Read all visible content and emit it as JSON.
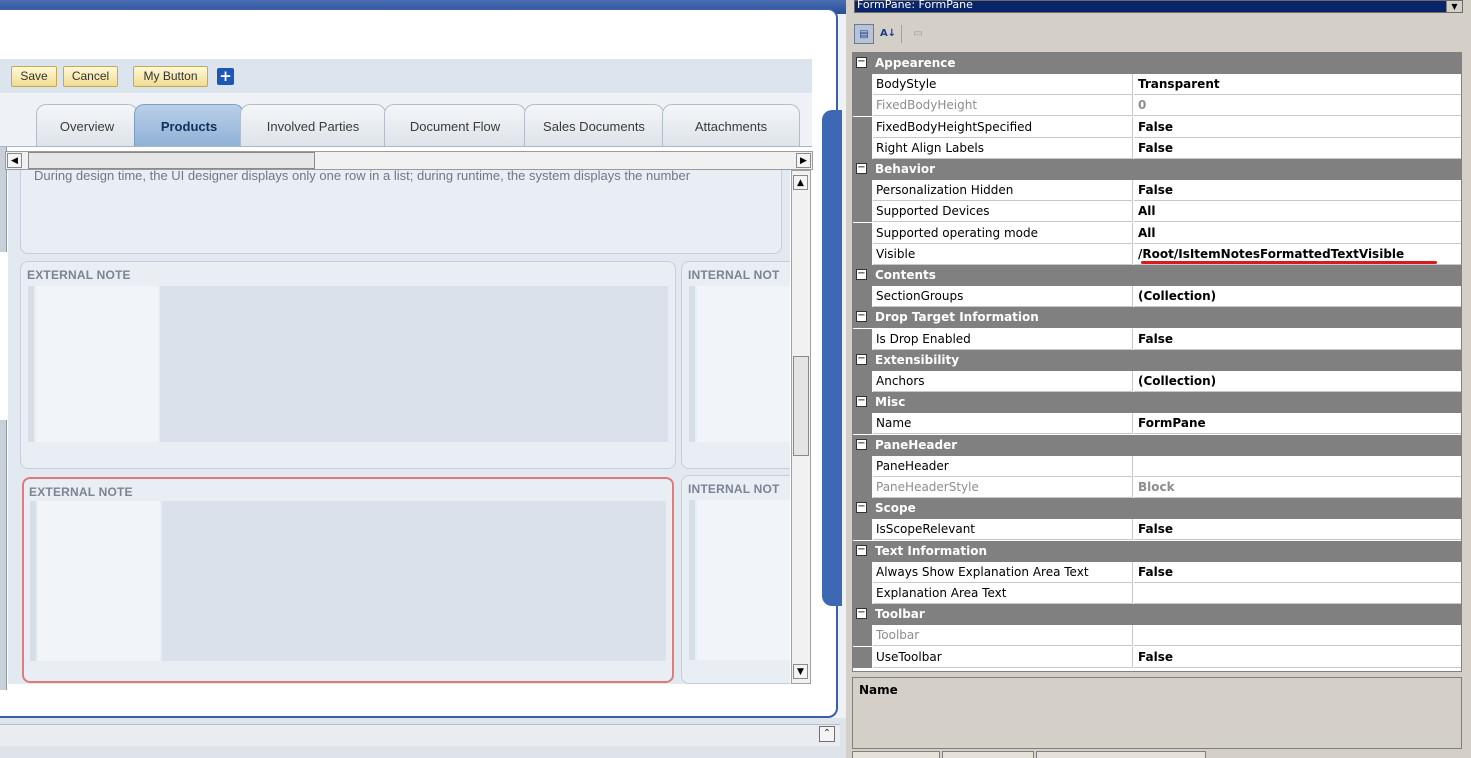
{
  "toolbar": {
    "buttons": [
      "Save",
      "Cancel",
      "My Button"
    ],
    "add_icon": "plus-icon"
  },
  "tabs": [
    {
      "label": "Overview",
      "active": false
    },
    {
      "label": "Products",
      "active": true
    },
    {
      "label": "Involved Parties",
      "active": false
    },
    {
      "label": "Document Flow",
      "active": false
    },
    {
      "label": "Sales Documents",
      "active": false
    },
    {
      "label": "Attachments",
      "active": false
    }
  ],
  "info_text": "During design time, the UI designer displays only one row in a list; during runtime, the system displays the number",
  "panels": {
    "external_note_1": "EXTERNAL NOTE",
    "internal_note_1": "INTERNAL NOT",
    "external_note_2": "EXTERNAL NOTE",
    "internal_note_2": "INTERNAL NOT"
  },
  "property_grid": {
    "object_selector": "FormPane: FormPane",
    "toolbar_icons": [
      "categorized-icon",
      "alphabetical-icon",
      "property-pages-icon"
    ],
    "highlight_color": "#d81a1a",
    "rows": [
      {
        "type": "category",
        "name": "Appearence"
      },
      {
        "type": "property",
        "name": "BodyStyle",
        "value": "Transparent"
      },
      {
        "type": "property",
        "name": "FixedBodyHeight",
        "value": "0",
        "dim": true
      },
      {
        "type": "property",
        "name": "FixedBodyHeightSpecified",
        "value": "False"
      },
      {
        "type": "property",
        "name": "Right Align Labels",
        "value": "False"
      },
      {
        "type": "category",
        "name": "Behavior"
      },
      {
        "type": "property",
        "name": "Personalization Hidden",
        "value": "False"
      },
      {
        "type": "property",
        "name": "Supported Devices",
        "value": "All"
      },
      {
        "type": "property",
        "name": "Supported operating mode",
        "value": "All"
      },
      {
        "type": "property",
        "name": "Visible",
        "value": "/Root/IsItemNotesFormattedTextVisible",
        "highlighted": true
      },
      {
        "type": "category",
        "name": "Contents"
      },
      {
        "type": "property",
        "name": "SectionGroups",
        "value": "(Collection)"
      },
      {
        "type": "category",
        "name": "Drop Target Information"
      },
      {
        "type": "property",
        "name": "Is Drop Enabled",
        "value": "False"
      },
      {
        "type": "category",
        "name": "Extensibility"
      },
      {
        "type": "property",
        "name": "Anchors",
        "value": "(Collection)"
      },
      {
        "type": "category",
        "name": "Misc"
      },
      {
        "type": "property",
        "name": "Name",
        "value": "FormPane"
      },
      {
        "type": "category",
        "name": "PaneHeader"
      },
      {
        "type": "property",
        "name": "PaneHeader",
        "value": ""
      },
      {
        "type": "property",
        "name": "PaneHeaderStyle",
        "value": "Block",
        "dim": true
      },
      {
        "type": "category",
        "name": "Scope"
      },
      {
        "type": "property",
        "name": "IsScopeRelevant",
        "value": "False"
      },
      {
        "type": "category",
        "name": "Text Information"
      },
      {
        "type": "property",
        "name": "Always Show Explanation Area Text",
        "value": "False"
      },
      {
        "type": "property",
        "name": "Explanation Area Text",
        "value": ""
      },
      {
        "type": "category",
        "name": "Toolbar"
      },
      {
        "type": "property",
        "name": "Toolbar",
        "value": "",
        "dim": true
      },
      {
        "type": "property",
        "name": "UseToolbar",
        "value": "False"
      }
    ],
    "description_title": "Name"
  }
}
